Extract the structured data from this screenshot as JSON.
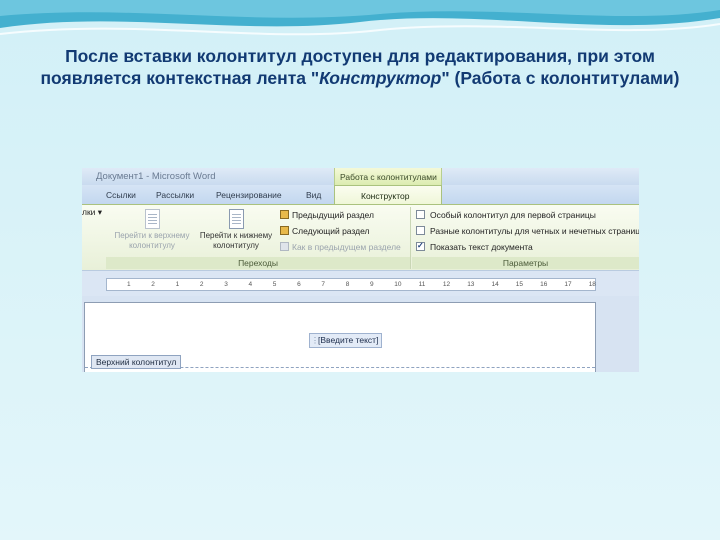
{
  "slide": {
    "title_part1": "После вставки колонтитул доступен для редактирования, при этом появляется контекстная лента \"",
    "title_italic": "Конструктор",
    "title_part2": "\" (Работа с колонтитулами)"
  },
  "window": {
    "title": "Документ1 - Microsoft Word",
    "context_header": "Работа с колонтитулами"
  },
  "tabs": [
    "Ссылки",
    "Рассылки",
    "Рецензирование",
    "Вид"
  ],
  "active_tab": "Конструктор",
  "ribbon": {
    "left_fragment": "лки ▾",
    "navigation": {
      "label": "Переходы",
      "goto_header": "Перейти к верхнему колонтитулу",
      "goto_footer": "Перейти к нижнему колонтитулу",
      "prev_section": "Предыдущий раздел",
      "next_section": "Следующий раздел",
      "link_previous": "Как в предыдущем разделе"
    },
    "options": {
      "label": "Параметры",
      "different_first_page": "Особый колонтитул для первой страницы",
      "different_odd_even": "Разные колонтитулы для четных и нечетных страниц",
      "show_document_text": "Показать текст документа",
      "checks": [
        false,
        false,
        true
      ]
    }
  },
  "ruler": {
    "ticks": [
      "1",
      "2",
      "1",
      "2",
      "3",
      "4",
      "5",
      "6",
      "7",
      "8",
      "9",
      "10",
      "11",
      "12",
      "13",
      "14",
      "15",
      "16",
      "17",
      "18"
    ]
  },
  "document": {
    "placeholder": "[Введите текст]",
    "header_label": "Верхний колонтитул"
  },
  "colors": {
    "title_text": "#123a73",
    "context_tab": "#dcecb1",
    "slide_background": "#d9f3f8"
  }
}
